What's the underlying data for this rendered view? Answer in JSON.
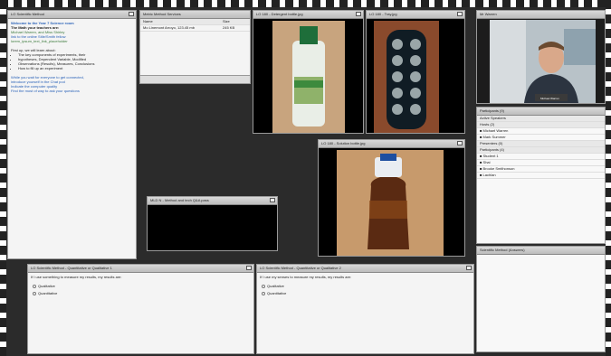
{
  "chat": {
    "title": "LO Scientific Method",
    "welcome_line": "Welcome to the Year 7 Science room",
    "teachers_line": "The Math your teachers are:",
    "teacher_names": "Michael Warren, and Miss Shirley",
    "links": [
      "link to the online Stile/Smith fellow",
      "lorem_ipsum_text_link_placeholder"
    ],
    "intro_line": "First up, we will learn about:",
    "bullets": [
      "The key components of experiments, their",
      "hypotheses, Dependent Variable, Modified",
      "Observations (Results), Measures, Conclusions",
      "How to fill up an experiment"
    ],
    "closing": [
      "While you wait for everyone to get connected,",
      "introduce yourself in the Chat pod",
      "Indicate the computer quality",
      "Find the most of way to ask your questions"
    ]
  },
  "file_share": {
    "title": "Metric Method Services",
    "columns": [
      "Name",
      "Size"
    ],
    "rows": [
      [
        "Mo Linemont Arroyo, 123.45 mb",
        "245 KB"
      ]
    ]
  },
  "images": [
    {
      "title": "LO 180 - Detergent bottle.jpg"
    },
    {
      "title": "LO 180 - Tray.jpg"
    },
    {
      "title": "LO 180 - Solution bottle.jpg"
    }
  ],
  "poll_small": {
    "title": "MLD N - Method and tech Q&A pass"
  },
  "webcam": {
    "title": "Mr Warren",
    "name_tag": "Michael Warren"
  },
  "attendees": {
    "title": "Participants (9)",
    "sections": [
      {
        "label": "Active Speakers",
        "items": []
      },
      {
        "label": "Hosts (2)",
        "items": [
          "Michael Warren",
          "Mark Summer"
        ]
      },
      {
        "label": "Presenters (0)",
        "items": []
      },
      {
        "label": "Participants (4)",
        "items": [
          "Student 1",
          "Shai",
          "Brooke Smithonson",
          "Lachlan"
        ]
      }
    ]
  },
  "notes": {
    "title": "Scientific Method (Answers)"
  },
  "poll1": {
    "title": "LO Scientific Method - Quantitative or Qualitative 1",
    "question": "If I use something to measure my results, my results are:",
    "options": [
      "Qualitative",
      "Quantitative"
    ]
  },
  "poll2": {
    "title": "LO Scientific Method - Quantitative or Qualitative 2",
    "question": "If I use my senses to measure my results, my results are:",
    "options": [
      "Qualitative",
      "Quantitative"
    ]
  }
}
